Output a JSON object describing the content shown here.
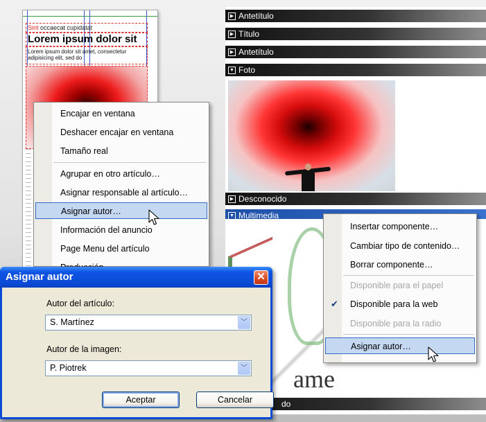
{
  "layout_preview": {
    "small_text_red": "Sint",
    "small_text": "occaecat cupidatat",
    "title": "Lorem ipsum dolor sit",
    "body": "Lorem ipsum dolor sit amet, consectetur adipisicing elit, sed do"
  },
  "sections": [
    {
      "label": "Antetítulo",
      "expanded": false
    },
    {
      "label": "Título",
      "expanded": false
    },
    {
      "label": "Antetítulo",
      "expanded": false
    },
    {
      "label": "Foto",
      "expanded": true
    },
    {
      "label": "Desconocido",
      "expanded": false
    },
    {
      "label": "Multimedia",
      "expanded": true
    },
    {
      "label": "do",
      "expanded": false
    }
  ],
  "multimedia_text": "ame",
  "image_menu": {
    "items": [
      {
        "label": "Encajar en ventana",
        "mnemonic": "E"
      },
      {
        "label": "Deshacer encajar en ventana",
        "mnemonic": "D"
      },
      {
        "label": "Tamaño real",
        "mnemonic": "T"
      },
      {
        "label": "Agrupar en otro artículo…",
        "mnemonic": "g"
      },
      {
        "label": "Asignar responsable al artículo…",
        "mnemonic": "A"
      },
      {
        "label": "Asignar autor…",
        "mnemonic": "A",
        "highlighted": true
      },
      {
        "label": "Información del anuncio",
        "mnemonic": "I"
      },
      {
        "label": "Page Menu del artículo",
        "mnemonic": ""
      },
      {
        "label": "Producción",
        "mnemonic": ""
      }
    ]
  },
  "component_menu": {
    "items": [
      {
        "label": "Insertar componente…",
        "disabled": false
      },
      {
        "label": "Cambiar tipo de contenido…",
        "disabled": false
      },
      {
        "label": "Borrar componente…",
        "disabled": false
      },
      {
        "label": "Disponible para el papel",
        "disabled": true
      },
      {
        "label": "Disponible para la web",
        "disabled": false,
        "checked": true
      },
      {
        "label": "Disponible para la radio",
        "disabled": true
      },
      {
        "label": "Asignar autor…",
        "disabled": false,
        "highlighted": true
      }
    ]
  },
  "dialog": {
    "title": "Asignar autor",
    "author_label": "Autor del artículo:",
    "author_value": "S. Martínez",
    "image_author_label": "Autor de la imagen:",
    "image_author_value": "P. Piotrek",
    "ok_label": "Aceptar",
    "cancel_label": "Cancelar"
  },
  "colors": {
    "accent": "#316ac5",
    "titlebar": "#0b49d3",
    "section_bar": "#222222",
    "close_button": "#d84a21"
  }
}
